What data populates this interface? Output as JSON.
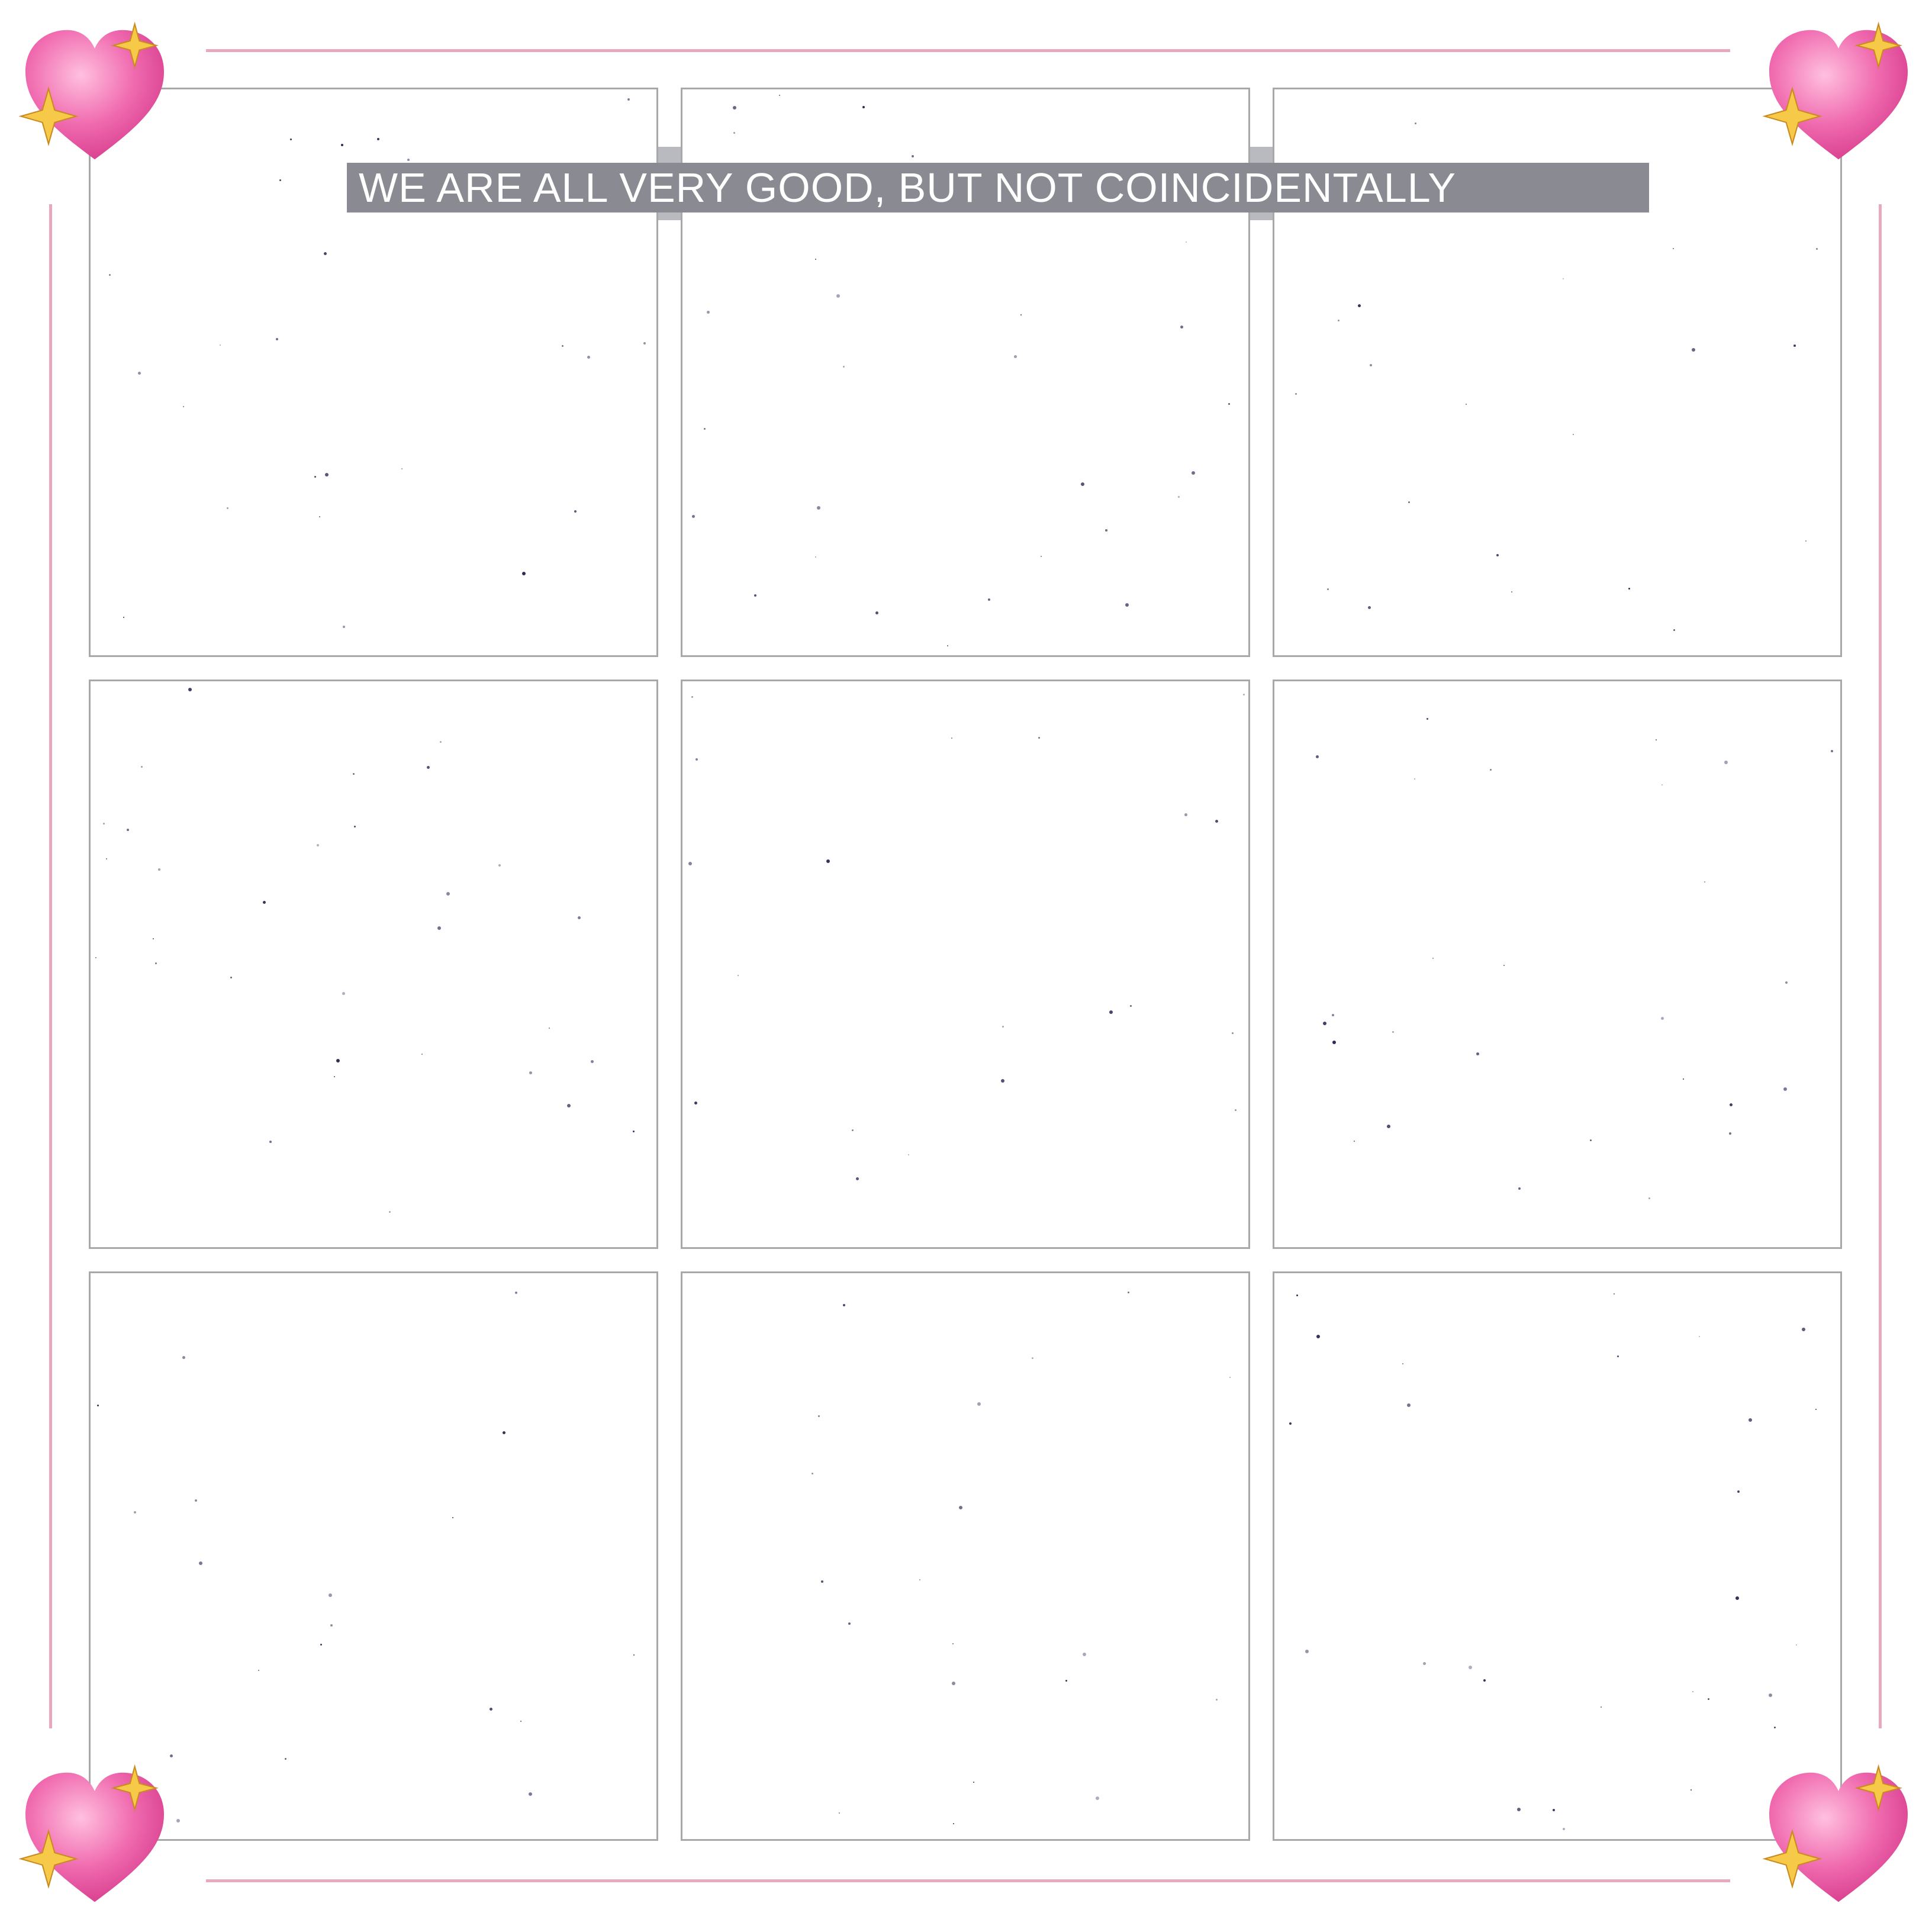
{
  "caption": {
    "text": "WE ARE ALL VERY GOOD,  BUT NOT COINCIDENTALLY"
  },
  "grid": {
    "rows": 3,
    "columns": 3,
    "cells": [
      "",
      "",
      "",
      "",
      "",
      "",
      "",
      "",
      ""
    ]
  },
  "decorations": {
    "corner_icon": "sparkling-heart-icon",
    "frame_color": "#e8a9bd",
    "heart_color": "#ef5fa7",
    "sparkle_color": "#f7c948",
    "caption_bg": "#8a8b92"
  }
}
